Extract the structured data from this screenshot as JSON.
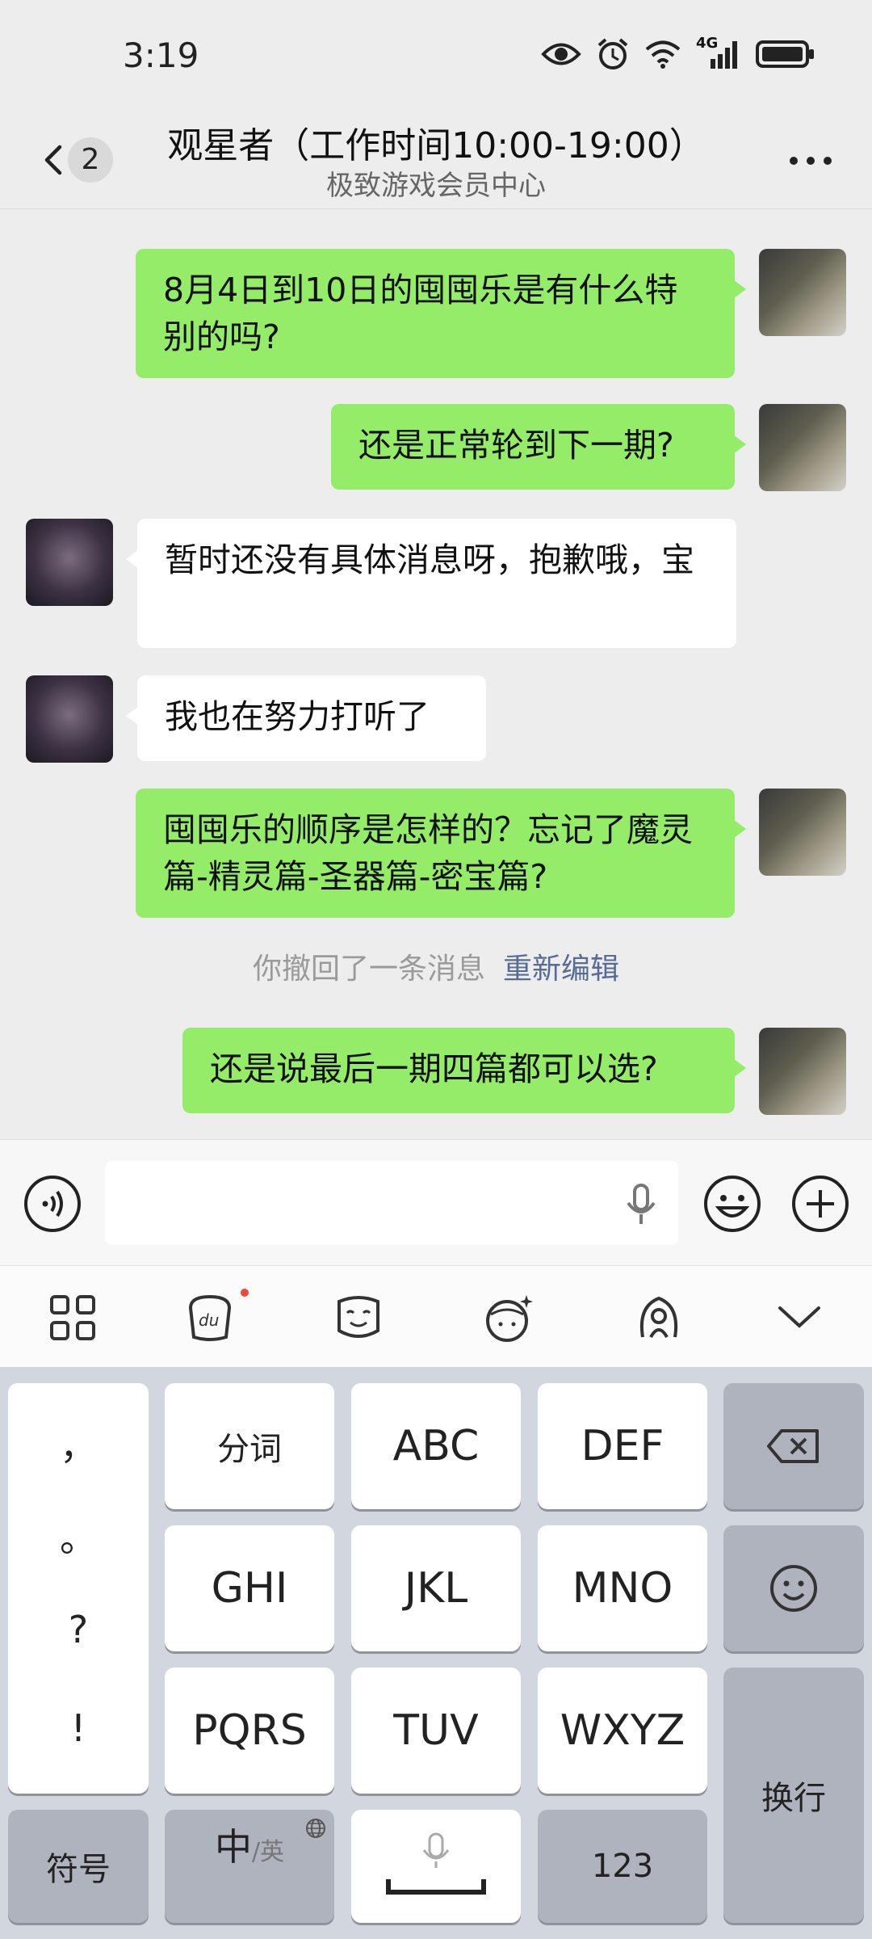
{
  "status_bar": {
    "time": "3:19",
    "network": "4G"
  },
  "header": {
    "unread_count": "2",
    "title": "观星者（工作时间10:00-19:00）",
    "subtitle": "极致游戏会员中心"
  },
  "messages": [
    {
      "sender": "me",
      "text": "8月4日到10日的囤囤乐是有什么特别的吗?"
    },
    {
      "sender": "me",
      "text": "还是正常轮到下一期?"
    },
    {
      "sender": "other",
      "text": "暂时还没有具体消息呀，抱歉哦，宝"
    },
    {
      "sender": "other",
      "text": "我也在努力打听了"
    },
    {
      "sender": "me",
      "text": "囤囤乐的顺序是怎样的？忘记了魔灵篇-精灵篇-圣器篇-密宝篇?"
    },
    {
      "sender": "me",
      "text": "还是说最后一期四篇都可以选?"
    }
  ],
  "recall_notice": {
    "text": "你撤回了一条消息",
    "edit_label": "重新编辑"
  },
  "input": {
    "value": "",
    "placeholder": ""
  },
  "keyboard": {
    "punctuation": [
      "，",
      "。",
      "?",
      "!"
    ],
    "row1": [
      "分词",
      "ABC",
      "DEF"
    ],
    "row2": [
      "GHI",
      "JKL",
      "MNO"
    ],
    "row3": [
      "PQRS",
      "TUV",
      "WXYZ"
    ],
    "symbols_label": "符号",
    "lang_main": "中",
    "lang_alt": "/英",
    "numbers_label": "123",
    "enter_label": "换行"
  }
}
